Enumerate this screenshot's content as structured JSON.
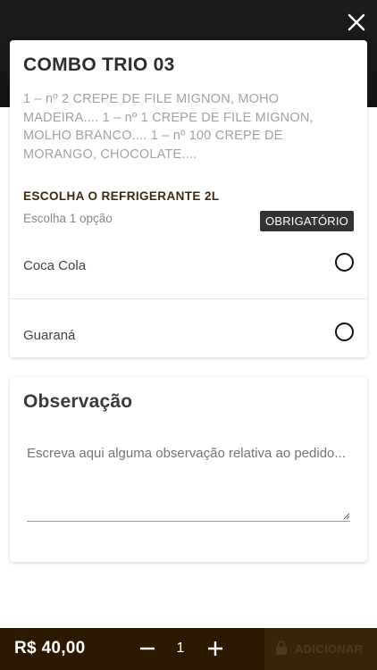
{
  "product": {
    "title": "COMBO TRIO 03",
    "description": "1 – nº 2 CREPE DE FILE MIGNON, MOHO MADEIRA.... 1 – nº 1 CREPE DE FILE MIGNON, MOLHO BRANCO.... 1 – nº 100 CREPE DE MORANGO, CHOCOLATE...."
  },
  "option_group": {
    "title": "ESCOLHA O REFRIGERANTE 2L",
    "subtitle": "Escolha 1 opção",
    "badge": "OBRIGATÓRIO",
    "options": [
      {
        "label": "Coca Cola",
        "selected": false
      },
      {
        "label": "Guaraná",
        "selected": false
      }
    ]
  },
  "observation": {
    "title": "Observação",
    "placeholder": "Escreva aqui alguma observação relativa ao pedido...",
    "value": ""
  },
  "footer": {
    "price": "R$ 40,00",
    "quantity": "1",
    "add_label": "ADICIONAR",
    "add_enabled": false
  },
  "icons": {
    "close": "close-icon",
    "minus": "minus-icon",
    "plus": "plus-icon",
    "lock": "lock-icon"
  },
  "colors": {
    "header_bg": "#1c1c1c",
    "footer_bg": "#2d1800",
    "badge_bg": "#333333",
    "group_title": "#3a2a0f"
  }
}
